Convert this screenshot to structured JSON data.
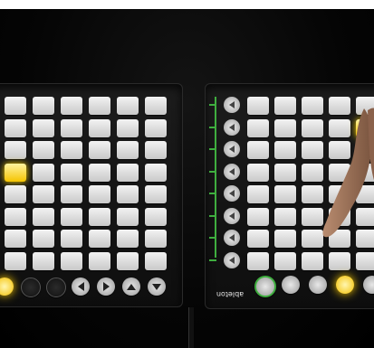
{
  "devices": [
    {
      "id": "left",
      "brand": "",
      "pad_columns": 6,
      "pad_rows": 8,
      "lit_pads": [
        [
          3,
          0
        ]
      ],
      "bottom_buttons": [
        "lit",
        "dark",
        "dark",
        "left-arrow",
        "right-arrow",
        "up-arrow",
        "down-arrow"
      ]
    },
    {
      "id": "right",
      "brand": "",
      "pad_columns": 5,
      "pad_rows": 8,
      "lit_pads": [
        [
          1,
          4
        ]
      ],
      "logo_text": "ableton",
      "bottom_buttons": [
        "ring",
        "round",
        "round",
        "lit",
        "round"
      ]
    }
  ],
  "colors": {
    "pad": "#e0e0e0",
    "lit": "#f5c400",
    "accent_green": "#3fae3f",
    "background": "#000000"
  }
}
